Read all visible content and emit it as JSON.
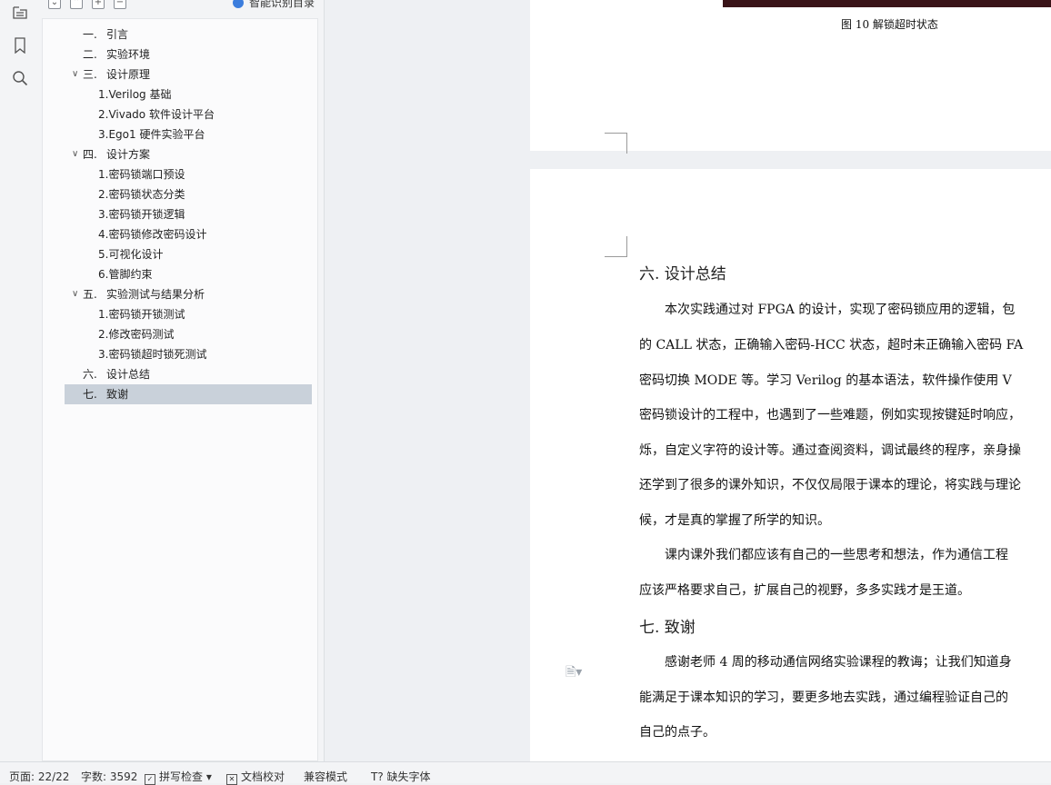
{
  "outline": {
    "smart_outline_label": "智能识别目录",
    "items": [
      {
        "num": "一.",
        "label": "引言"
      },
      {
        "num": "二.",
        "label": "实验环境"
      },
      {
        "num": "三.",
        "label": "设计原理"
      },
      {
        "num": "",
        "label": "1.Verilog 基础"
      },
      {
        "num": "",
        "label": "2.Vivado 软件设计平台"
      },
      {
        "num": "",
        "label": "3.Ego1 硬件实验平台"
      },
      {
        "num": "四.",
        "label": "设计方案"
      },
      {
        "num": "",
        "label": "1.密码锁端口预设"
      },
      {
        "num": "",
        "label": "2.密码锁状态分类"
      },
      {
        "num": "",
        "label": "3.密码锁开锁逻辑"
      },
      {
        "num": "",
        "label": "4.密码锁修改密码设计"
      },
      {
        "num": "",
        "label": "5.可视化设计"
      },
      {
        "num": "",
        "label": "6.管脚约束"
      },
      {
        "num": "五.",
        "label": "实验测试与结果分析"
      },
      {
        "num": "",
        "label": "1.密码锁开锁测试"
      },
      {
        "num": "",
        "label": "2.修改密码测试"
      },
      {
        "num": "",
        "label": "3.密码锁超时锁死测试"
      },
      {
        "num": "六.",
        "label": "设计总结"
      },
      {
        "num": "七.",
        "label": "致谢"
      }
    ]
  },
  "document": {
    "figure_caption": "图 10 解锁超时状态",
    "heading6": "六.  设计总结",
    "para1": [
      "本次实践通过对 FPGA 的设计，实现了密码锁应用的逻辑，包",
      "的 CALL 状态，正确输入密码-HCC 状态，超时未正确输入密码 FA",
      "密码切换 MODE 等。学习 Verilog 的基本语法，软件操作使用 V",
      "密码锁设计的工程中，也遇到了一些难题，例如实现按键延时响应，",
      "烁，自定义字符的设计等。通过查阅资料，调试最终的程序，亲身操",
      "还学到了很多的课外知识，不仅仅局限于课本的理论，将实践与理论",
      "候，才是真的掌握了所学的知识。"
    ],
    "para2": [
      "课内课外我们都应该有自己的一些思考和想法，作为通信工程",
      "应该严格要求自己，扩展自己的视野，多多实践才是王道。"
    ],
    "heading7": "七.  致谢",
    "para3": [
      "感谢老师 4 周的移动通信网络实验课程的教诲；让我们知道身",
      "能满足于课本知识的学习，要更多地去实践，通过编程验证自己的",
      "自己的点子。"
    ]
  },
  "status": {
    "page": "页面: 22/22",
    "words": "字数: 3592",
    "spell": "拼写检查",
    "proof": "文档校对",
    "compat": "兼容模式",
    "missing_font": "缺失字体"
  }
}
